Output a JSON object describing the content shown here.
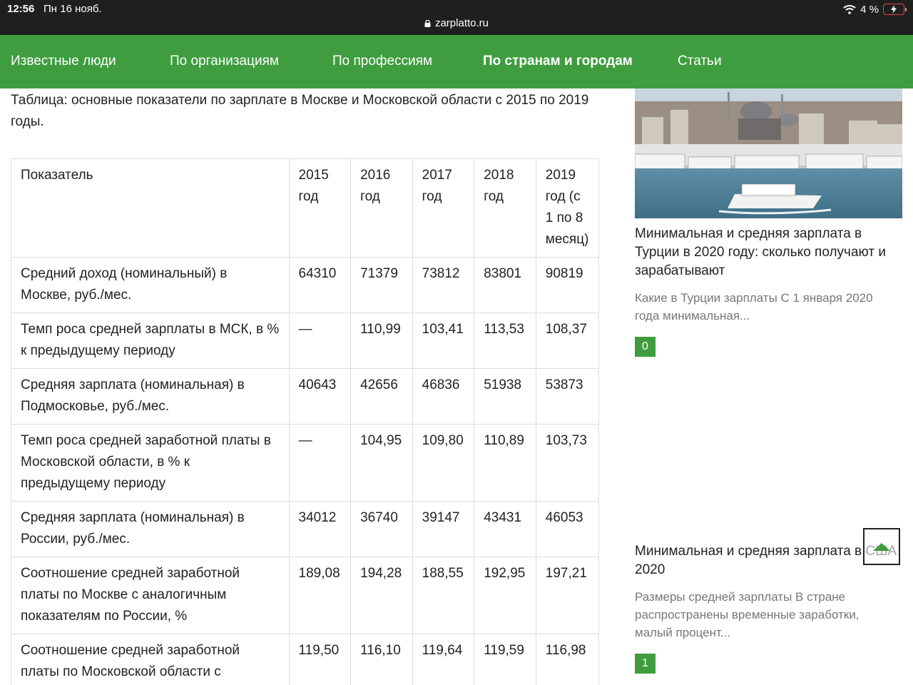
{
  "status_bar": {
    "time": "12:56",
    "date": "Пн 16 нояб.",
    "url": "zarplatto.ru",
    "battery": "4 %"
  },
  "nav": {
    "items": [
      {
        "label": "Известные люди"
      },
      {
        "label": "По организациям"
      },
      {
        "label": "По профессиям"
      },
      {
        "label": "По странам и городам",
        "active": true
      },
      {
        "label": "Статьи"
      }
    ]
  },
  "main": {
    "intro": "Таблица: основные показатели по зарплате в Москве и Московской области с 2015 по 2019 годы.",
    "table": {
      "headers": [
        "Показатель",
        "2015 год",
        "2016 год",
        "2017 год",
        "2018 год",
        "2019 год (с 1 по 8 месяц)"
      ],
      "rows": [
        [
          "Средний доход (номинальный) в Москве, руб./мес.",
          "64310",
          "71379",
          "73812",
          "83801",
          "90819"
        ],
        [
          "Темп роса средней зарплаты в МСК, в % к предыдущему периоду",
          "—",
          "110,99",
          "103,41",
          "113,53",
          "108,37"
        ],
        [
          "Средняя зарплата (номинальная) в Подмосковье, руб./мес.",
          "40643",
          "42656",
          "46836",
          "51938",
          "53873"
        ],
        [
          "Темп роса средней заработной платы в Московской области, в % к предыдущему периоду",
          "—",
          "104,95",
          "109,80",
          "110,89",
          "103,73"
        ],
        [
          "Средняя зарплата (номинальная) в России, руб./мес.",
          "34012",
          "36740",
          "39147",
          "43431",
          "46053"
        ],
        [
          "Соотношение средней заработной платы по Москве с аналогичным показателям по России, %",
          "189,08",
          "194,28",
          "188,55",
          "192,95",
          "197,21"
        ],
        [
          "Соотношение средней заработной платы по Московской области с аналогичным показателям по",
          "119,50",
          "116,10",
          "119,64",
          "119,59",
          "116,98"
        ]
      ]
    }
  },
  "sidebar": {
    "cards": [
      {
        "title": "Минимальная и средняя зарплата в Турции в 2020 году: сколько получают и зарабатывают",
        "excerpt": "Какие в Турции зарплаты С 1 января 2020 года минимальная...",
        "comments": "0"
      },
      {
        "title": "Минимальная и средняя зарплата в США 2020",
        "excerpt": "Размеры средней зарплаты В стране распространены временные заработки, малый процент...",
        "comments": "1"
      }
    ]
  },
  "colors": {
    "brand_green": "#3f9d3f",
    "status_bar": "#1f1f1f"
  },
  "icons": [
    "lock-icon",
    "wifi-icon",
    "battery-charging-icon",
    "scroll-to-top-icon"
  ]
}
